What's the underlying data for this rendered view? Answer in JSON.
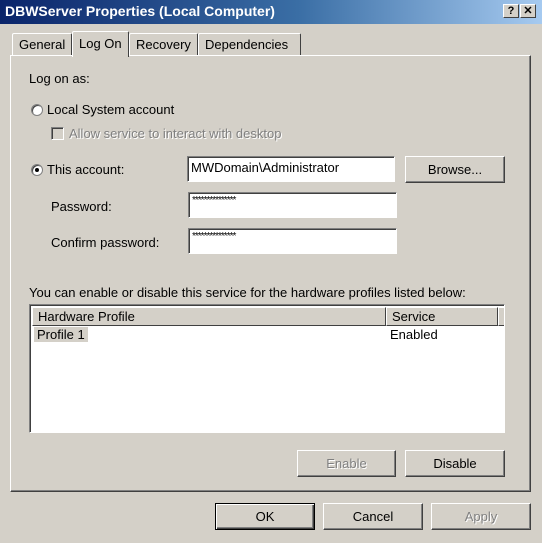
{
  "window": {
    "title": "DBWServer Properties (Local Computer)",
    "help_button": "?",
    "close_button": "✕"
  },
  "tabs": [
    {
      "label": "General",
      "active": false
    },
    {
      "label": "Log On",
      "active": true
    },
    {
      "label": "Recovery",
      "active": false
    },
    {
      "label": "Dependencies",
      "active": false
    }
  ],
  "logon": {
    "section_label": "Log on as:",
    "local_system": {
      "label": "Local System account",
      "checked": false
    },
    "interact_desktop": {
      "label": "Allow service to interact with desktop",
      "checked": false,
      "enabled": false
    },
    "this_account": {
      "label": "This account:",
      "checked": true,
      "value": "MWDomain\\Administrator"
    },
    "browse_label": "Browse...",
    "password": {
      "label": "Password:",
      "value": "***************"
    },
    "confirm_password": {
      "label": "Confirm password:",
      "value": "***************"
    }
  },
  "profiles": {
    "description": "You can enable or disable this service for the hardware profiles listed below:",
    "columns": [
      "Hardware Profile",
      "Service"
    ],
    "rows": [
      {
        "profile": "Profile 1",
        "service": "Enabled"
      }
    ],
    "enable_label": "Enable",
    "disable_label": "Disable"
  },
  "footer": {
    "ok_label": "OK",
    "cancel_label": "Cancel",
    "apply_label": "Apply"
  },
  "colors": {
    "face": "#d4d0c8",
    "title_start": "#0a246a",
    "title_end": "#a6caf0",
    "disabled_text": "#808080"
  }
}
